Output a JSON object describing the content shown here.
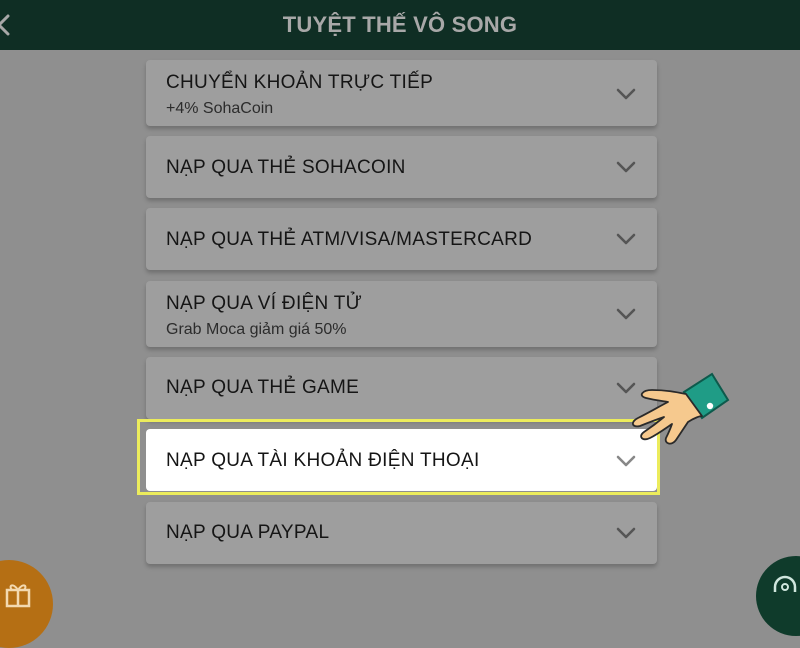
{
  "header": {
    "title": "TUYỆT THẾ VÔ SONG"
  },
  "methods": [
    {
      "label": "CHUYỂN KHOẢN TRỰC TIẾP",
      "sub": "+4% SohaCoin"
    },
    {
      "label": "NẠP QUA THẺ SOHACOIN",
      "sub": ""
    },
    {
      "label": "NẠP QUA THẺ ATM/VISA/MASTERCARD",
      "sub": ""
    },
    {
      "label": "NẠP QUA VÍ ĐIỆN TỬ",
      "sub": "Grab Moca giảm giá 50%"
    },
    {
      "label": "NẠP QUA THẺ GAME",
      "sub": ""
    },
    {
      "label": "NẠP QUA TÀI KHOẢN ĐIỆN THOẠI",
      "sub": ""
    },
    {
      "label": "NẠP QUA PAYPAL",
      "sub": ""
    }
  ],
  "icons": {
    "back": "chevron-left-icon",
    "expand": "chevron-down-icon",
    "pointer": "pointing-hand-icon",
    "gift": "gift-icon",
    "support": "headset-icon"
  },
  "colors": {
    "header_bg": "#0f2e24",
    "overlay_bg": "#8f8f8f",
    "card_bg": "#9e9e9e",
    "highlight_card_bg": "#ffffff",
    "highlight_frame": "#ecec5c",
    "gift_button": "#b56f14",
    "support_button": "#0f3b2b"
  }
}
